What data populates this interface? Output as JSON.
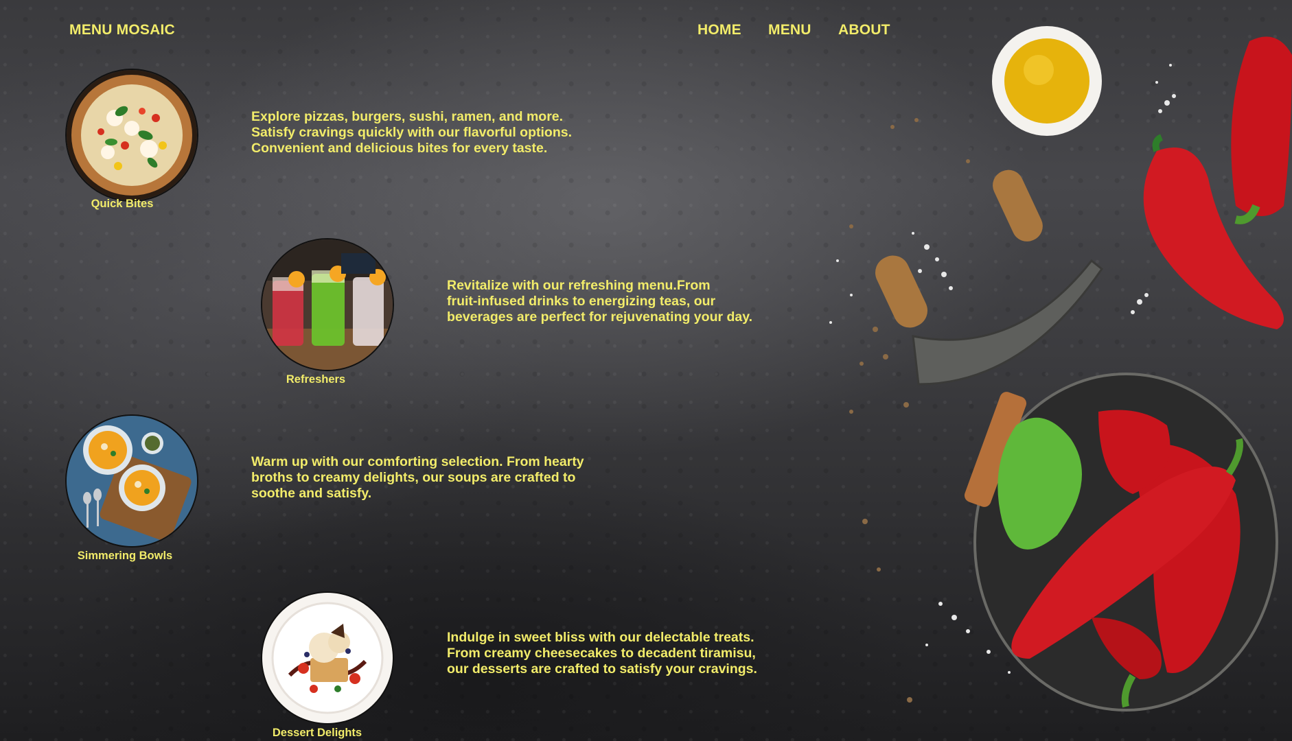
{
  "header": {
    "logo": "MENU MOSAIC",
    "nav": [
      "HOME",
      "MENU",
      "ABOUT"
    ]
  },
  "categories": [
    {
      "name": "Quick Bites",
      "icon": "pizza-image",
      "description": [
        "Explore pizzas, burgers, sushi, ramen, and more.",
        "Satisfy cravings quickly with our flavorful options.",
        "Convenient and delicious bites for every taste."
      ]
    },
    {
      "name": "Refreshers",
      "icon": "drinks-image",
      "description": [
        "Revitalize with our refreshing menu.From",
        "fruit-infused drinks to energizing teas, our",
        "beverages are perfect for rejuvenating your day."
      ]
    },
    {
      "name": "Simmering Bowls",
      "icon": "soup-image",
      "description": [
        "Warm up with our comforting selection. From hearty",
        "broths to creamy delights, our soups are crafted to",
        "soothe and satisfy."
      ]
    },
    {
      "name": "Dessert Delights",
      "icon": "dessert-image",
      "description": [
        "Indulge in sweet bliss with our delectable treats.",
        "From creamy cheesecakes to decadent tiramisu,",
        "our desserts are crafted to satisfy your cravings."
      ]
    }
  ],
  "colors": {
    "accent": "#f2ec6a",
    "background": "#3a3a3d"
  }
}
